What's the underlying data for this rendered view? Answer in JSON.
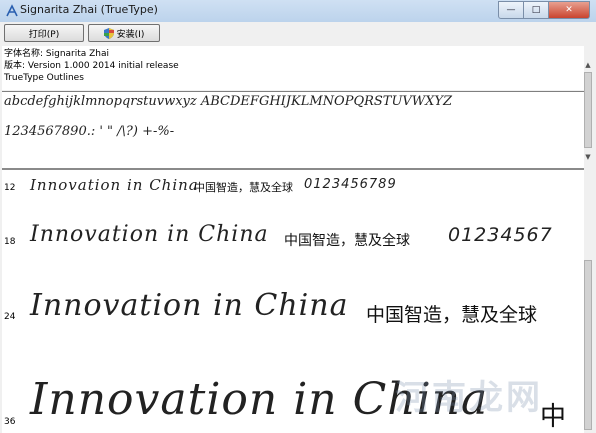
{
  "window": {
    "title": "Signarita Zhai (TrueType)",
    "minimize_glyph": "—",
    "maximize_glyph": "□",
    "close_glyph": "✕"
  },
  "toolbar": {
    "print_label": "打印(P)",
    "install_label": "安装(I)"
  },
  "font_info": {
    "name_line": "字体名称: Signarita Zhai",
    "version_line": "版本: Version 1.000 2014 initial release",
    "outline_line": "TrueType Outlines"
  },
  "charset": {
    "line1": "abcdefghijklmnopqrstuvwxyz ABCDEFGHIJKLMNOPQRSTUVWXYZ",
    "line2": "1234567890.: ' \" /\\?) +-%-"
  },
  "samples": [
    {
      "size": "12",
      "script": "Innovation in China",
      "cjk": "中国智造，慧及全球",
      "digits": "0123456789"
    },
    {
      "size": "18",
      "script": "Innovation in China",
      "cjk": "中国智造，慧及全球",
      "digits": "01234567"
    },
    {
      "size": "24",
      "script": "Innovation in China",
      "cjk": "中国智造，慧及全球",
      "digits": ""
    },
    {
      "size": "36",
      "script": "Innovation in China",
      "cjk": "中",
      "digits": ""
    }
  ],
  "watermark": "河南龙网"
}
